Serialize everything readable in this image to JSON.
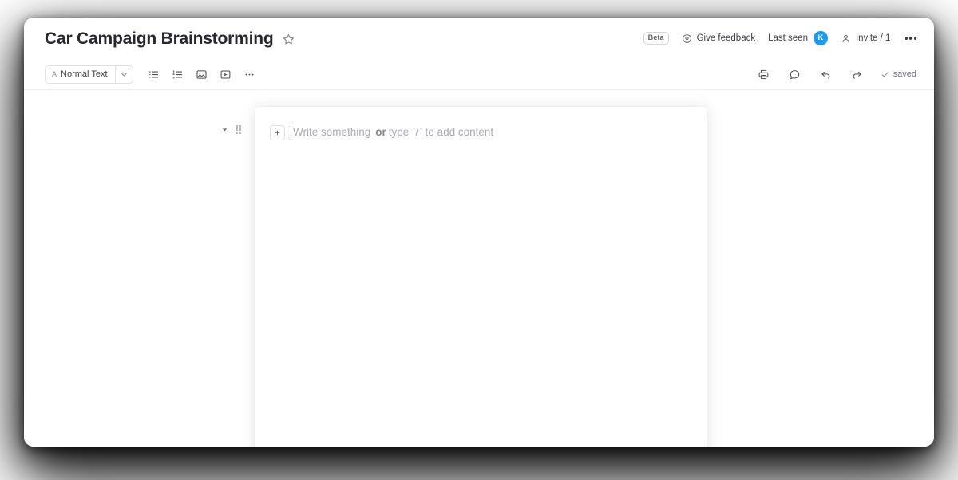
{
  "window": {
    "header": {
      "title": "Car Campaign Brainstorming",
      "star_icon": "star-outline-icon",
      "beta_badge": "Beta",
      "feedback_label": "Give feedback",
      "feedback_icon": "megaphone-icon",
      "last_seen_label": "Last seen",
      "avatar_initial": "K",
      "avatar_color": "#1d9bf0",
      "invite_label": "Invite / 1",
      "invite_icon": "person-icon",
      "more_icon": "kebab-menu-icon"
    },
    "toolbar": {
      "style_label": "Normal Text",
      "style_glyph": "A",
      "caret_icon": "chevron-down-icon",
      "buttons": [
        {
          "name": "bulleted-list",
          "icon": "bulleted-list-icon"
        },
        {
          "name": "numbered-list",
          "icon": "numbered-list-icon"
        },
        {
          "name": "insert-image",
          "icon": "image-icon"
        },
        {
          "name": "insert-video",
          "icon": "video-icon"
        },
        {
          "name": "more-options",
          "icon": "ellipsis-icon"
        }
      ],
      "right_actions": [
        {
          "name": "print",
          "icon": "printer-icon"
        },
        {
          "name": "comment",
          "icon": "comment-bubble-icon"
        },
        {
          "name": "undo",
          "icon": "undo-arrow-icon"
        },
        {
          "name": "redo",
          "icon": "redo-arrow-icon"
        }
      ],
      "saved_label": "saved",
      "saved_icon": "checkmark-icon"
    },
    "editor": {
      "block_caret_icon": "caret-down-icon",
      "drag_handle_icon": "drag-handle-icon",
      "add_block_icon": "plus-icon",
      "placeholder_part1": "Write something",
      "placeholder_bold": "or",
      "placeholder_part2": "type `/` to add content"
    }
  }
}
